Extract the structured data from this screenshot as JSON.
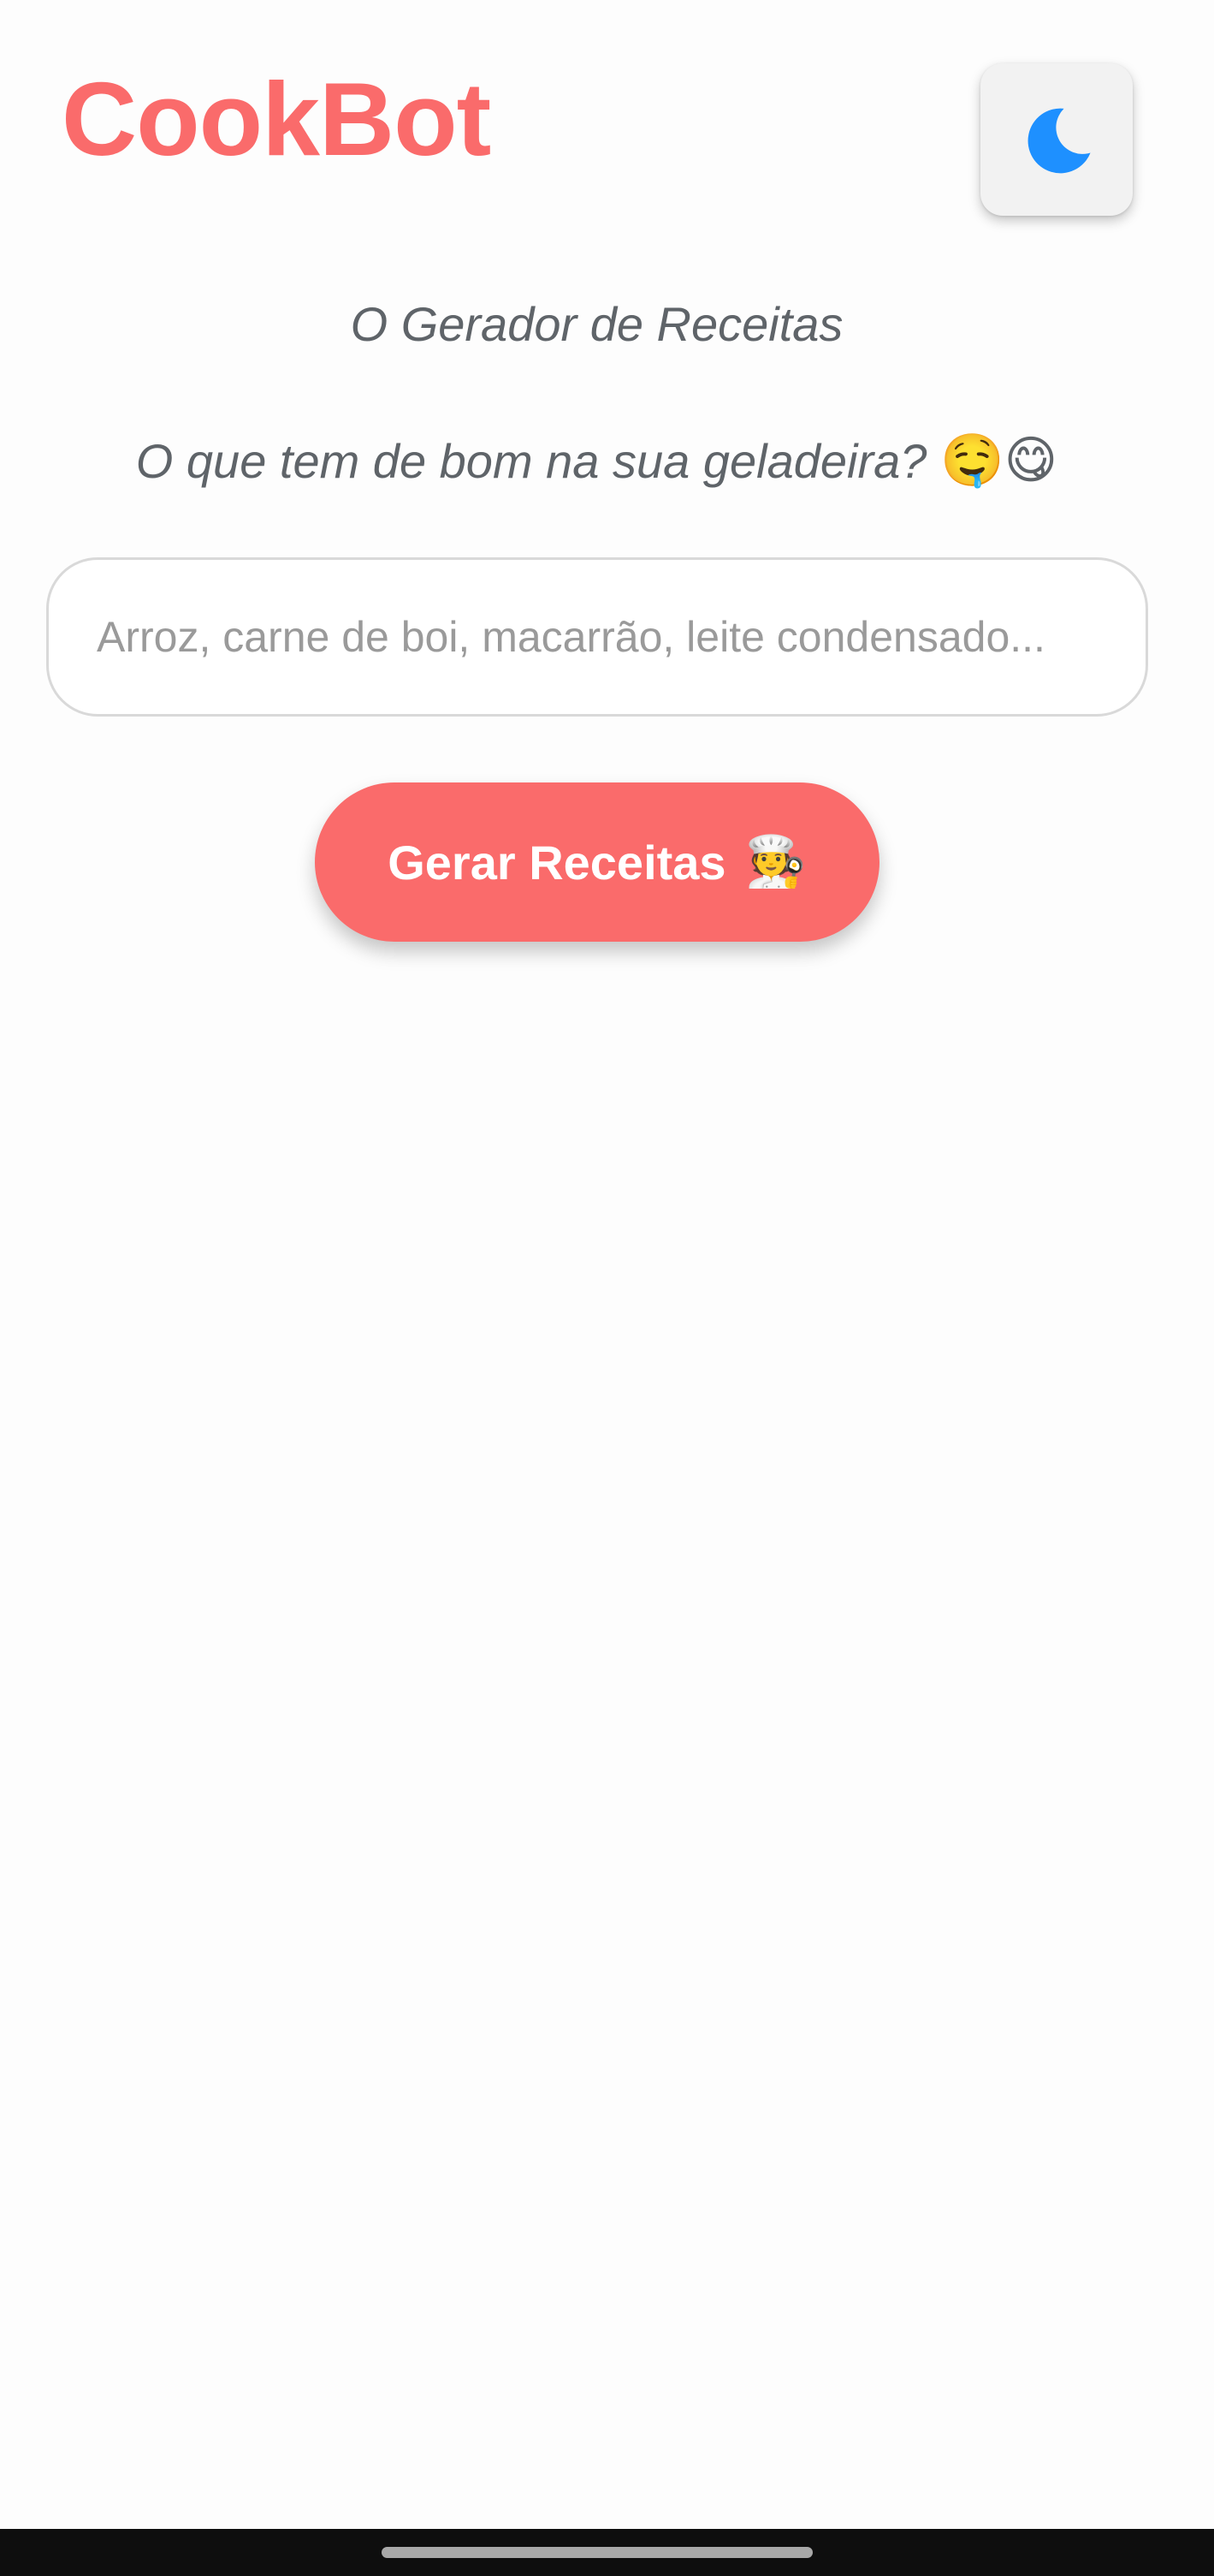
{
  "header": {
    "title": "CookBot",
    "theme_toggle_icon": "moon-icon",
    "accent_color": "#fa6b6b",
    "icon_color": "#1e90ff"
  },
  "main": {
    "subtitle": "O Gerador de Receitas",
    "question": "O que tem de bom na sua geladeira?",
    "question_emojis": "🤤😋",
    "ingredients_input": {
      "value": "",
      "placeholder": "Arroz, carne de boi, macarrão, leite condensado..."
    },
    "generate_button": {
      "label": "Gerar Receitas",
      "emoji": "🧑‍🍳"
    }
  }
}
